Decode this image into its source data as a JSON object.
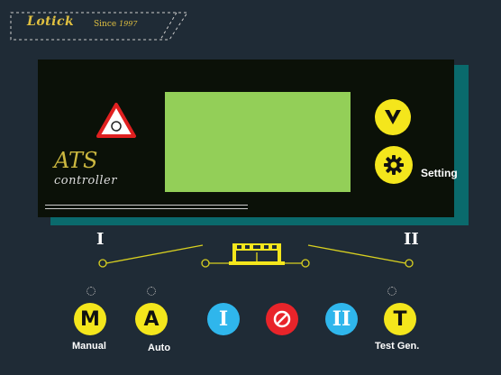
{
  "brand": {
    "name": "Lotick",
    "since_label": "Since",
    "since_year": "1997"
  },
  "panel": {
    "title": "ATS",
    "subtitle": "controller",
    "setting_label": "Setting"
  },
  "diagram": {
    "source1": "I",
    "source2": "II"
  },
  "buttons": {
    "manual": {
      "glyph": "M",
      "label": "Manual"
    },
    "auto": {
      "glyph": "A",
      "label": "Auto"
    },
    "source1": {
      "glyph": "I"
    },
    "stop": {
      "glyph": "stop-icon"
    },
    "source2": {
      "glyph": "II"
    },
    "test": {
      "glyph": "T",
      "label": "Test Gen."
    }
  },
  "colors": {
    "background": "#1f2b36",
    "lcd": "#93cf58",
    "accent_yellow": "#f4e61c",
    "source_blue": "#2fb6ec",
    "stop_red": "#e8242a",
    "panel_teal": "#0a6a6c"
  }
}
